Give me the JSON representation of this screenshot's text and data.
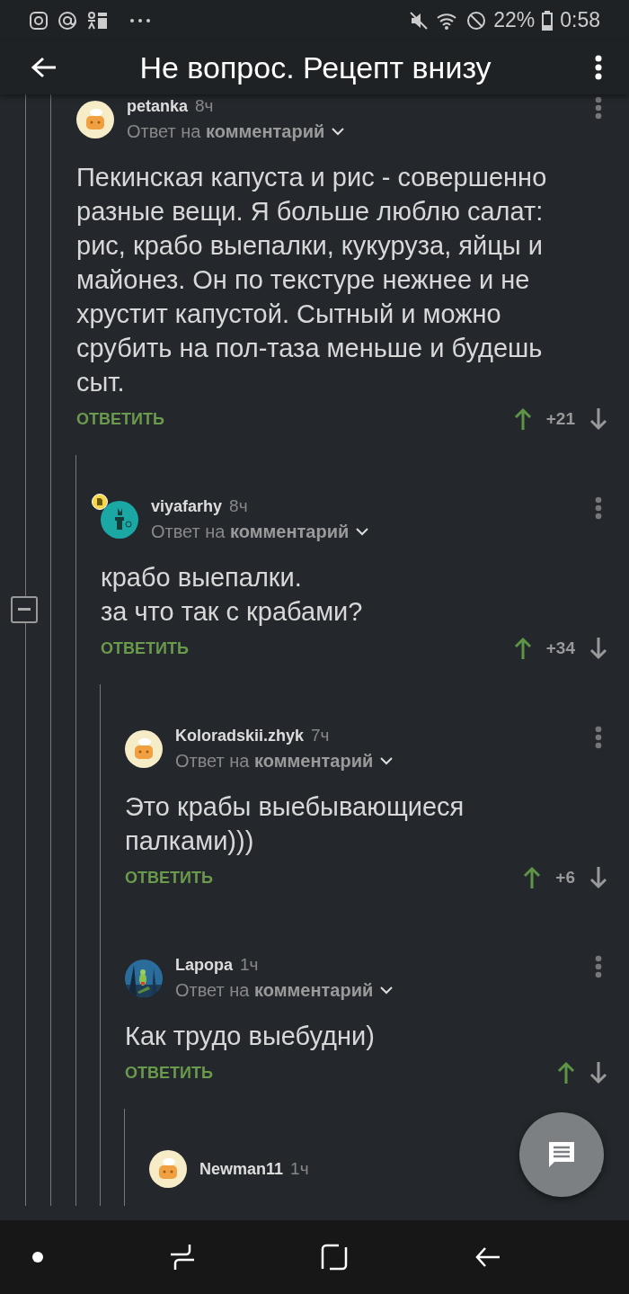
{
  "status_bar": {
    "battery": "22%",
    "time": "0:58"
  },
  "header": {
    "title": "Не вопрос. Рецепт внизу"
  },
  "comments": [
    {
      "author": "petanka",
      "time": "8ч",
      "avatar": {
        "kind": "default"
      },
      "badge": false,
      "reply_to": "Ответ на **комментарий**",
      "text": "Пекинская капуста и рис - совершенно разные вещи. Я больше люблю салат: рис, крабо выепалки, кукуруза, яйцы и майонез. Он по текстуре нежнее и не хрустит капустой. Сытный и можно срубить на пол-таза меньше и будешь сыт.",
      "reply_label": "ОТВЕТИТЬ",
      "score": "+21",
      "children": [
        {
          "author": "viyafarhy",
          "time": "8ч",
          "avatar": {
            "kind": "teal"
          },
          "badge": true,
          "reply_to": "Ответ на **комментарий**",
          "text": "крабо выепалки.\nза что так с крабами?",
          "reply_label": "ОТВЕТИТЬ",
          "score": "+34",
          "children": [
            {
              "author": "Koloradskii.zhyk",
              "time": "7ч",
              "avatar": {
                "kind": "default"
              },
              "badge": false,
              "reply_to": "Ответ на **комментарий**",
              "text": "Это крабы выебывающиеся палками)))",
              "reply_label": "ОТВЕТИТЬ",
              "score": "+6"
            },
            {
              "author": "Lapopa",
              "time": "1ч",
              "avatar": {
                "kind": "picture"
              },
              "badge": false,
              "reply_to": "Ответ на **комментарий**",
              "text": "Как трудо выебудни)",
              "reply_label": "ОТВЕТИТЬ",
              "children": [
                {
                  "author": "Newman11",
                  "time": "1ч",
                  "avatar": {
                    "kind": "default"
                  },
                  "badge": false
                }
              ]
            }
          ]
        }
      ]
    }
  ]
}
